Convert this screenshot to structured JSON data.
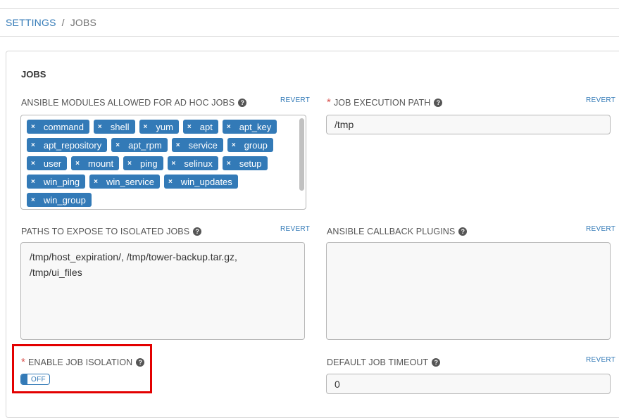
{
  "breadcrumb": {
    "settings": "SETTINGS",
    "separator": "/",
    "current": "JOBS"
  },
  "card": {
    "title": "JOBS"
  },
  "ansible_modules": {
    "label": "ANSIBLE MODULES ALLOWED FOR AD HOC JOBS",
    "revert": "REVERT",
    "tags": [
      "command",
      "shell",
      "yum",
      "apt",
      "apt_key",
      "apt_repository",
      "apt_rpm",
      "service",
      "group",
      "user",
      "mount",
      "ping",
      "selinux",
      "setup",
      "win_ping",
      "win_service",
      "win_updates",
      "win_group"
    ]
  },
  "job_execution_path": {
    "label": "JOB EXECUTION PATH",
    "required": "*",
    "revert": "REVERT",
    "value": "/tmp"
  },
  "paths_to_expose": {
    "label": "PATHS TO EXPOSE TO ISOLATED JOBS",
    "revert": "REVERT",
    "line1": "/tmp/host_expiration/, /tmp/tower-backup.tar.gz,",
    "line2": "/tmp/ui_files"
  },
  "callback_plugins": {
    "label": "ANSIBLE CALLBACK PLUGINS",
    "revert": "REVERT",
    "value": ""
  },
  "job_isolation": {
    "label": "ENABLE JOB ISOLATION",
    "required": "*",
    "toggle": "OFF"
  },
  "job_timeout": {
    "label": "DEFAULT JOB TIMEOUT",
    "revert": "REVERT",
    "value": "0"
  },
  "icons": {
    "help": "question-circle-icon",
    "remove": "times-icon"
  },
  "colors": {
    "accent": "#337ab7",
    "required": "#d9534f",
    "highlight": "#e30000"
  }
}
